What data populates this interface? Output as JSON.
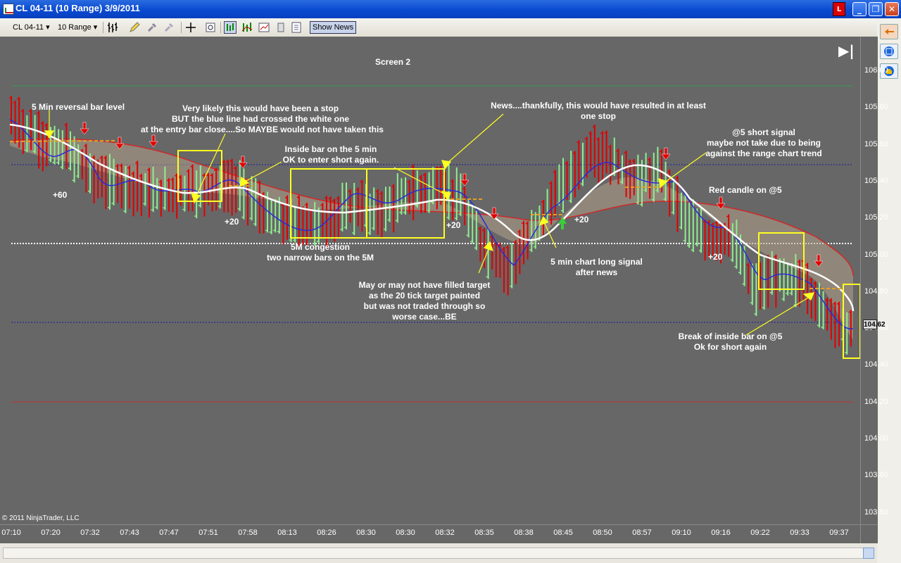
{
  "window": {
    "title": "CL 04-11 (10 Range)  3/9/2011",
    "connection_indicator": "L",
    "min_icon": "minimize-icon",
    "max_icon": "restore-icon",
    "close_icon": "close-icon"
  },
  "toolbar": {
    "instrument": "CL 04-11",
    "interval": "10 Range",
    "show_news": "Show News"
  },
  "chart": {
    "screen_label": "Screen 2",
    "copyright": "© 2011 NinjaTrader, LLC",
    "last_price": "104.62",
    "y_ticks": [
      "106.00",
      "105.80",
      "105.60",
      "105.40",
      "105.20",
      "105.00",
      "104.80",
      "104.60",
      "104.40",
      "104.20",
      "104.00",
      "103.80",
      "103.60"
    ],
    "x_ticks": [
      "07:10",
      "07:20",
      "07:32",
      "07:43",
      "07:47",
      "07:51",
      "07:58",
      "08:13",
      "08:26",
      "08:30",
      "08:30",
      "08:32",
      "08:35",
      "08:38",
      "08:45",
      "08:50",
      "08:57",
      "09:10",
      "09:16",
      "09:22",
      "09:33",
      "09:37"
    ],
    "annotations": {
      "reversal": "5 Min reversal bar level",
      "stop1": "Very likely this would have been a stop",
      "stop2": "BUT the blue line had crossed the white one",
      "stop3": "at the entry bar close....So MAYBE would not have taken this",
      "inside1": "Inside bar on the 5 min",
      "inside2": "OK to enter short again.",
      "news1": "News....thankfully, this would have resulted in at least",
      "news2": "one stop",
      "short1": "@5 short signal",
      "short2": "maybe not take due to being",
      "short3": "against the range chart trend",
      "red_candle": "Red candle on @5",
      "cong1": "5M congestion",
      "cong2": "two narrow bars on the 5M",
      "target1": "May or may not have filled target",
      "target2": "as the 20 tick target painted",
      "target3": "but was not traded through so",
      "target4": "worse case...BE",
      "long1": "5 min chart long signal",
      "long2": "after news",
      "break1": "Break of inside bar on @5",
      "break2": "Ok for short again",
      "p60": "+60",
      "p20a": "+20",
      "p20b": "+20",
      "p20c": "+20",
      "p20d": "+20"
    }
  },
  "colors": {
    "background": "#676767",
    "up_bar": "#90ee90",
    "down_bar": "#e00000",
    "blue_line": "#2a2ad8",
    "white_line": "#ffffff",
    "highlight_box": "#ffff22",
    "signal_arrow": "#e00000"
  }
}
